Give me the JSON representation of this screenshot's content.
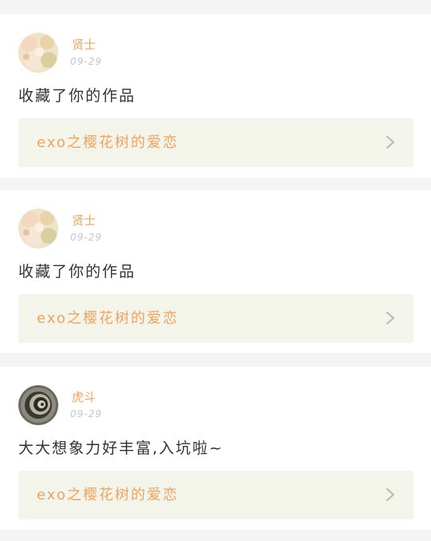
{
  "feed": {
    "items": [
      {
        "username": "贤士",
        "time": "09-29",
        "action": "收藏了你的作品",
        "work_title": "exo之樱花树的爱恋",
        "avatar_icon": "flower-photo-avatar"
      },
      {
        "username": "贤士",
        "time": "09-29",
        "action": "收藏了你的作品",
        "work_title": "exo之樱花树的爱恋",
        "avatar_icon": "flower-photo-avatar"
      },
      {
        "username": "虎斗",
        "time": "09-29",
        "action": "大大想象力好丰富,入坑啦~",
        "work_title": "exo之樱花树的爱恋",
        "avatar_icon": "swirl-photo-avatar"
      }
    ]
  },
  "colors": {
    "accent": "#f0a35f",
    "card_bg": "#ffffff",
    "page_bg": "#f4f4f4",
    "link_bg": "#f3f5ea",
    "time": "#c6c6c6",
    "text": "#333333",
    "chevron": "#b8b8b8"
  }
}
